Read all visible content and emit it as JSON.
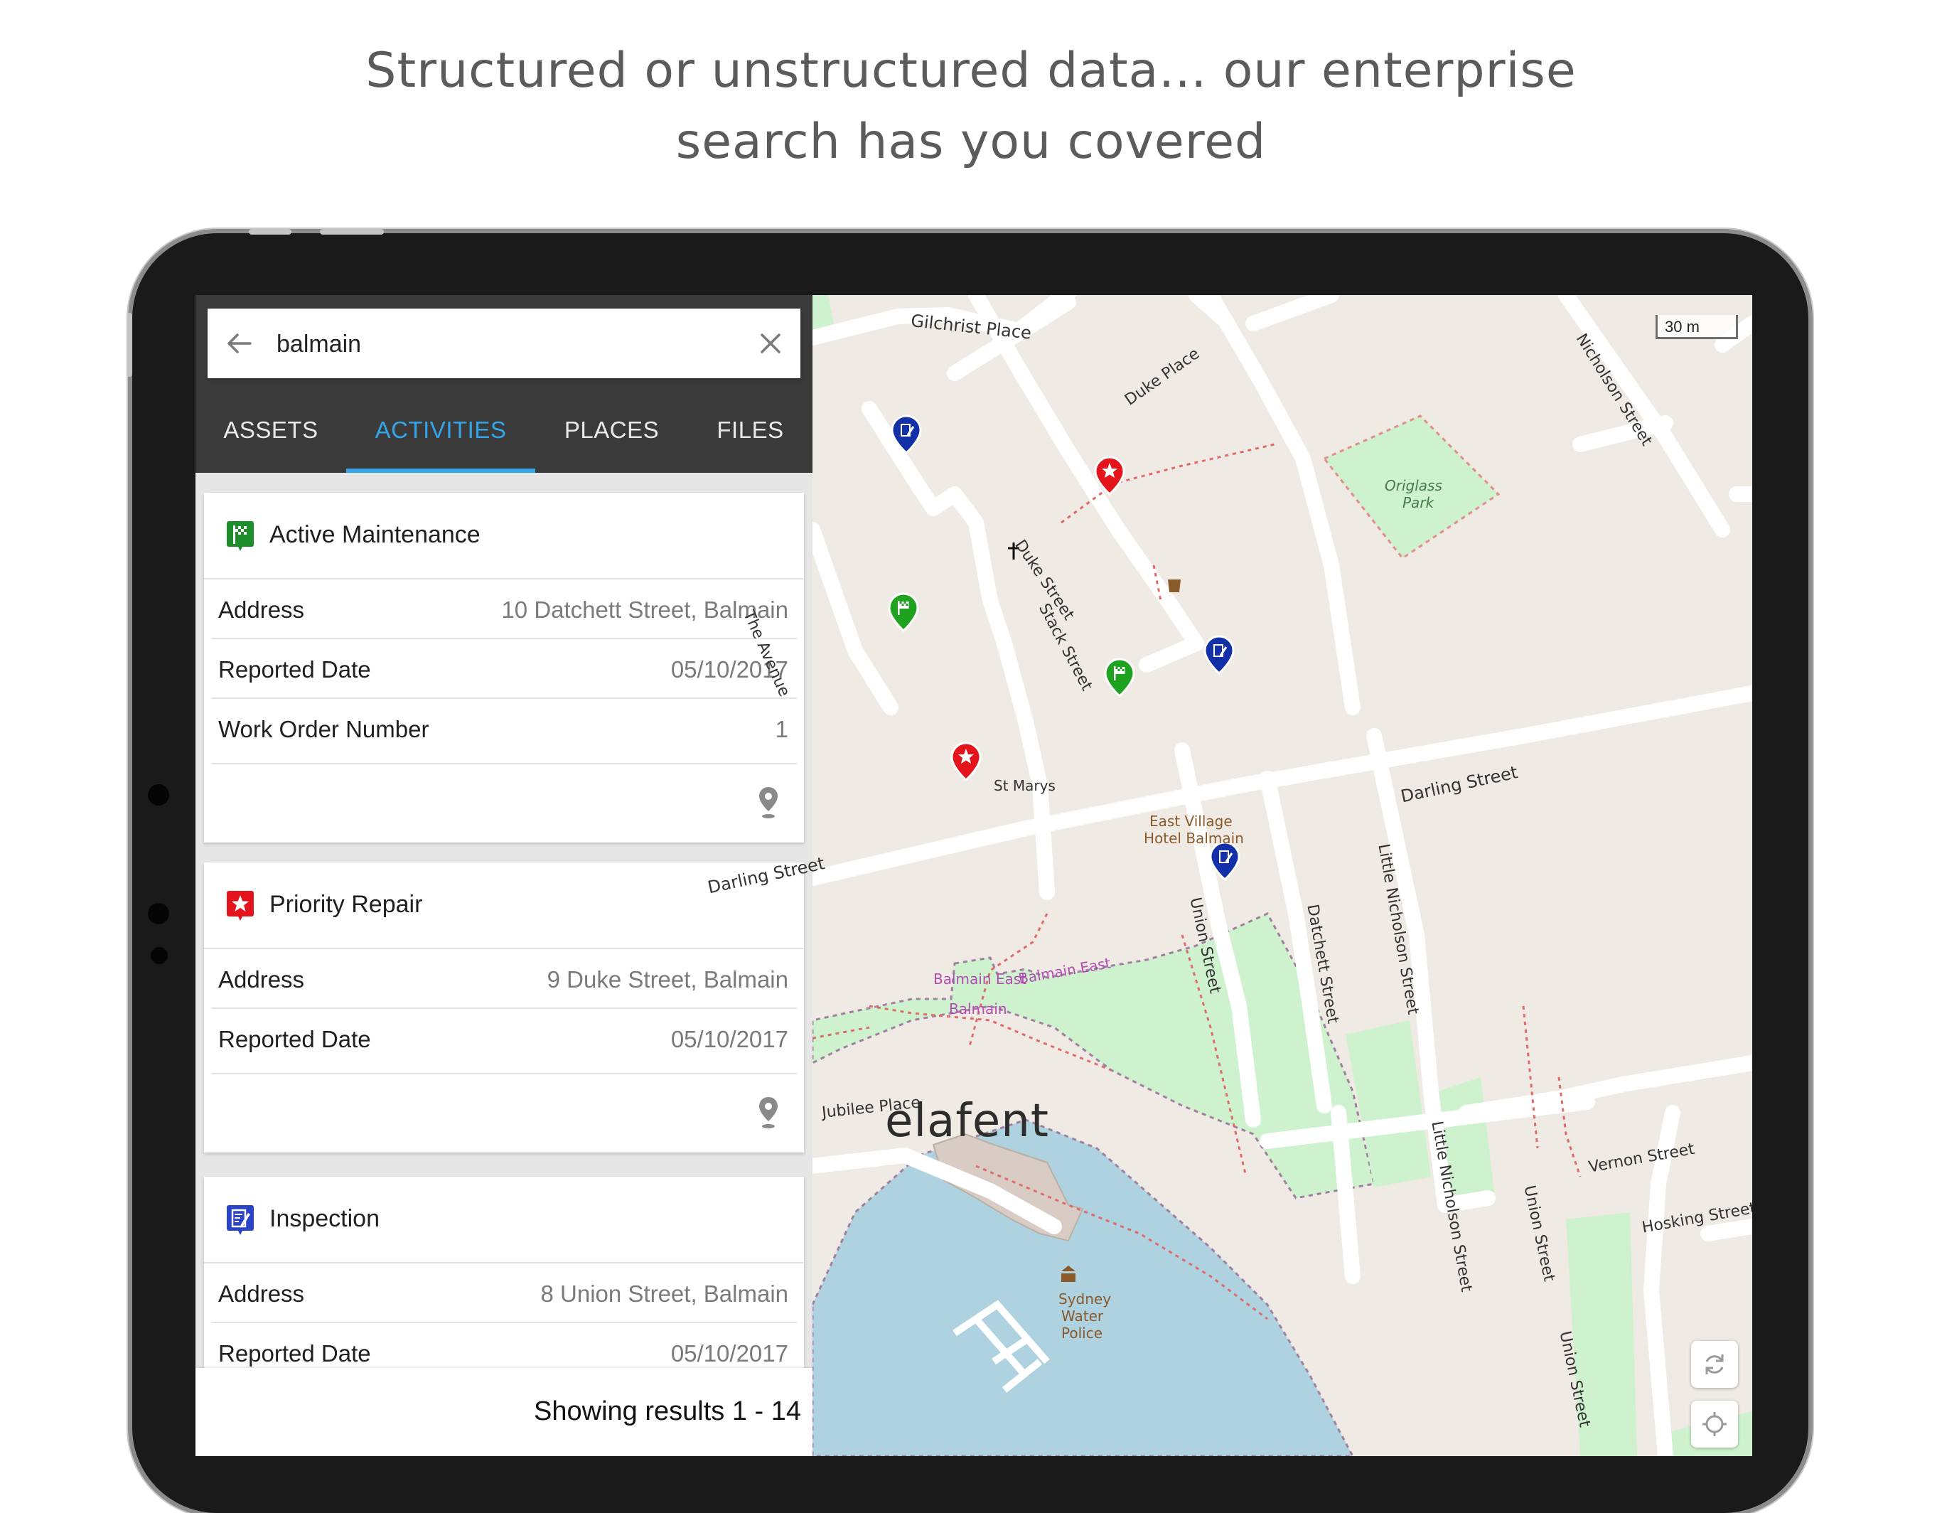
{
  "headline": {
    "line1": "Structured or unstructured data... our enterprise",
    "line2": "search has you covered"
  },
  "search": {
    "value": "balmain",
    "back_icon": "arrow-left-icon",
    "clear_icon": "close-icon"
  },
  "tabs": [
    {
      "label": "ASSETS",
      "active": false
    },
    {
      "label": "ACTIVITIES",
      "active": true
    },
    {
      "label": "PLACES",
      "active": false
    },
    {
      "label": "FILES",
      "active": false
    }
  ],
  "cards": [
    {
      "title": "Active Maintenance",
      "icon": "maintenance-flag-icon",
      "rows": [
        {
          "key": "Address",
          "value": "10 Datchett Street, Balmain"
        },
        {
          "key": "Reported Date",
          "value": "05/10/2017"
        },
        {
          "key": "Work Order Number",
          "value": "1"
        }
      ]
    },
    {
      "title": "Priority Repair",
      "icon": "priority-star-icon",
      "rows": [
        {
          "key": "Address",
          "value": "9 Duke Street, Balmain"
        },
        {
          "key": "Reported Date",
          "value": "05/10/2017"
        }
      ]
    },
    {
      "title": "Inspection",
      "icon": "inspection-clipboard-icon",
      "rows": [
        {
          "key": "Address",
          "value": "8 Union Street, Balmain"
        },
        {
          "key": "Reported Date",
          "value": "05/10/2017"
        }
      ]
    }
  ],
  "results_text": "Showing results 1 - 14",
  "map": {
    "scale_label": "30 m",
    "brand": "elafent",
    "streets": {
      "gilchrist": "Gilchrist Place",
      "duke_place": "Duke Place",
      "nicholson": "Nicholson Street",
      "duke_street": "Duke Street",
      "stack": "Stack Street",
      "the_avenue": "The Avenue",
      "darling_right": "Darling Street",
      "darling_left": "Darling Street",
      "datchett": "Datchett Street",
      "little_nicholson_1": "Little Nicholson Street",
      "little_nicholson_2": "Little Nicholson Street",
      "union_1": "Union Street",
      "union_2": "Union Street",
      "union_3": "Union Street",
      "jubilee": "Jubilee Place",
      "vernon": "Vernon Street",
      "hosking": "Hosking Street"
    },
    "pois": {
      "origlass_1": "Origlass",
      "origlass_2": "Park",
      "st_marys": "St Marys",
      "hotel_1": "East Village",
      "hotel_2": "Hotel Balmain",
      "balmain_east_1": "Balmain East",
      "balmain_east_2": "Balmain",
      "balmain_east_3": "Balmain East",
      "police_1": "Sydney",
      "police_2": "Water",
      "police_3": "Police"
    },
    "marker_colors": {
      "maintenance": "#1fa21f",
      "repair": "#e3141b",
      "inspection": "#1230a8"
    },
    "tool_icons": [
      "refresh-icon",
      "locate-icon"
    ]
  }
}
